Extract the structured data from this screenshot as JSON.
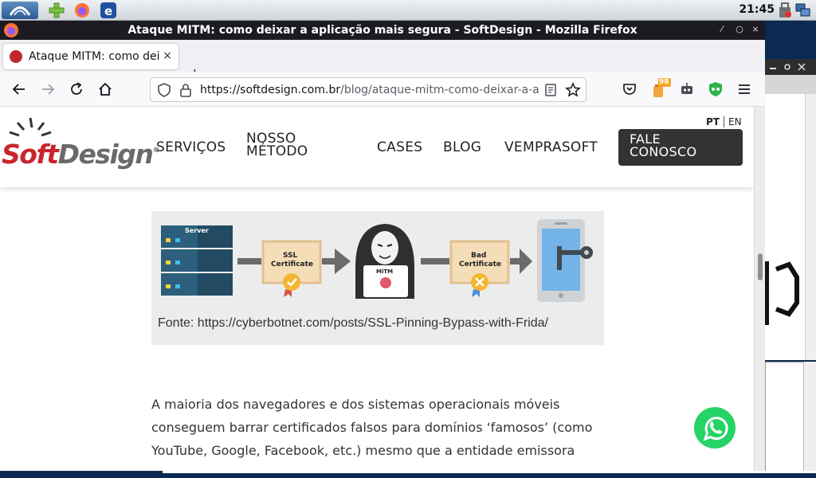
{
  "taskbar": {
    "clock": "21:45"
  },
  "window": {
    "title": "Ataque MITM: como deixar a aplicação mais segura - SoftDesign - Mozilla Firefox"
  },
  "tab": {
    "label": "Ataque MITM: como deixar a aplicação mais segura - SoftDesign",
    "close": "×"
  },
  "newtab": "+",
  "urlbar": {
    "domain": "https://softdesign.com.br",
    "path": "/blog/ataque-mitm-como-deixar-a-aplicacao-mais-segura/"
  },
  "toolbar": {
    "addon_badge": "98"
  },
  "site": {
    "logo": {
      "soft": "Soft",
      "design": "Design",
      "reg": "®"
    },
    "nav": [
      "SERVIÇOS",
      "NOSSO",
      "MÉTODO",
      "CASES",
      "BLOG",
      "VEMPRASOFT"
    ],
    "cta": [
      "FALE",
      "CONOSCO"
    ],
    "lang": {
      "pt": "PT",
      "en": "EN"
    }
  },
  "figure": {
    "server_label": "Server",
    "ssl_label_1": "SSL",
    "ssl_label_2": "Certificate",
    "mitm_label": "MiTM",
    "bad_label_1": "Bad",
    "bad_label_2": "Certificate",
    "caption": "Fonte: https://cyberbotnet.com/posts/SSL-Pinning-Bypass-with-Frida/"
  },
  "article": {
    "lines": [
      "A maioria dos navegadores e dos sistemas operacionais móveis",
      "conseguem barrar certificados falsos para domínios ‘famosos’ (como",
      "YouTube, Google, Facebook, etc.) mesmo que a entidade emissora"
    ]
  }
}
